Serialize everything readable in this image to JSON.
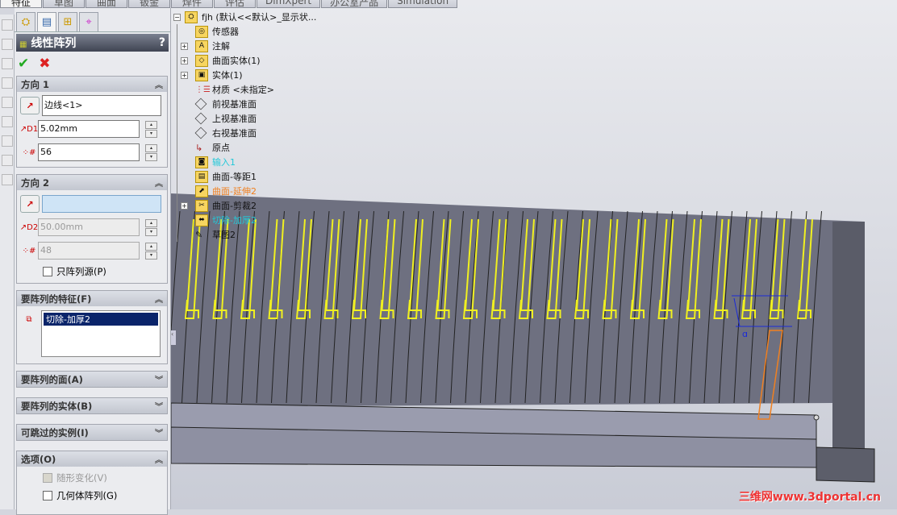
{
  "command_tabs": [
    "特征",
    "草图",
    "曲面",
    "钣金",
    "焊件",
    "评估",
    "DimXpert",
    "办公室产品",
    "Simulation"
  ],
  "active_tab": 0,
  "panel": {
    "tabs": [
      {
        "icon": "feature-manager-icon"
      },
      {
        "icon": "property-manager-icon"
      },
      {
        "icon": "configuration-manager-icon"
      },
      {
        "icon": "dimxpert-manager-icon"
      }
    ],
    "title": "线性阵列",
    "help": "?",
    "ok": "✔",
    "cancel": "✖",
    "dir1": {
      "header": "方向 1",
      "edge": "边线<1>",
      "spacing": "5.02mm",
      "count": "56"
    },
    "dir2": {
      "header": "方向 2",
      "edge": "",
      "spacing": "50.00mm",
      "count": "48",
      "only_seed": "只阵列源(P)",
      "only_seed_checked": false
    },
    "features": {
      "header": "要阵列的特征(F)",
      "items": [
        "切除-加厚2"
      ]
    },
    "faces": {
      "header": "要阵列的面(A)"
    },
    "bodies": {
      "header": "要阵列的实体(B)"
    },
    "skip": {
      "header": "可跳过的实例(I)"
    },
    "options": {
      "header": "选项(O)",
      "vary": "随形变化(V)",
      "geometry": "几何体阵列(G)"
    }
  },
  "tree": {
    "root": "fjh (默认<<默认>_显示状...",
    "items": [
      {
        "label": "传感器",
        "icon": "sensor-folder-icon",
        "expand": false,
        "color": "#111111"
      },
      {
        "label": "注解",
        "icon": "annotation-folder-icon",
        "expand": true,
        "color": "#111111"
      },
      {
        "label": "曲面实体(1)",
        "icon": "surface-bodies-folder-icon",
        "expand": true,
        "color": "#111111"
      },
      {
        "label": "实体(1)",
        "icon": "solid-bodies-folder-icon",
        "expand": true,
        "color": "#111111"
      },
      {
        "label": "材质 <未指定>",
        "icon": "material-icon",
        "expand": false,
        "color": "#111111"
      },
      {
        "label": "前视基准面",
        "icon": "plane-icon",
        "expand": false,
        "color": "#111111"
      },
      {
        "label": "上视基准面",
        "icon": "plane-icon",
        "expand": false,
        "color": "#111111"
      },
      {
        "label": "右视基准面",
        "icon": "plane-icon",
        "expand": false,
        "color": "#111111"
      },
      {
        "label": "原点",
        "icon": "origin-icon",
        "expand": false,
        "color": "#111111"
      },
      {
        "label": "输入1",
        "icon": "import-icon",
        "expand": false,
        "color": "#22c8d8"
      },
      {
        "label": "曲面-等距1",
        "icon": "surface-offset-icon",
        "expand": false,
        "color": "#111111"
      },
      {
        "label": "曲面-延伸2",
        "icon": "surface-extend-icon",
        "expand": false,
        "color": "#f08020"
      },
      {
        "label": "曲面-剪裁2",
        "icon": "surface-trim-icon",
        "expand": true,
        "color": "#111111"
      },
      {
        "label": "切除-加厚2",
        "icon": "cut-thicken-icon",
        "expand": false,
        "color": "#22c8d8"
      },
      {
        "label": "草图2",
        "icon": "sketch-icon",
        "expand": false,
        "color": "#111111"
      }
    ]
  },
  "toolbar": [
    "zoom-to-fit-icon",
    "zoom-area-icon",
    "previous-view-icon",
    "section-view-icon",
    "view-orientation-icon",
    "display-style-icon",
    "hide-show-icon",
    "appearance-icon",
    "scene-icon",
    "view-settings-icon"
  ],
  "watermark": "三维网www.3dportal.cn",
  "colors": {
    "selection": "#f0f020",
    "highlight": "#f08020",
    "dimension": "#1a2ad8",
    "model": "#6e7080"
  }
}
